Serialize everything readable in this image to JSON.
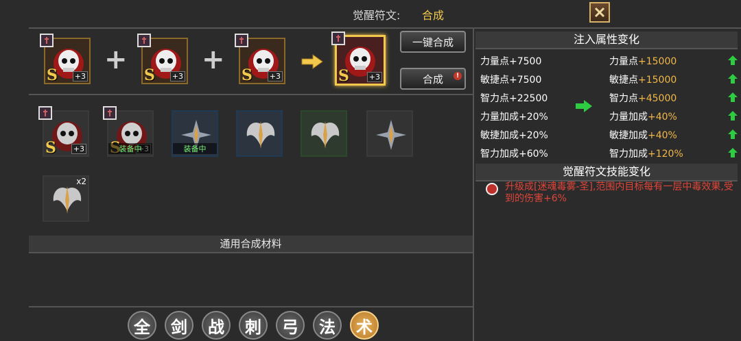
{
  "header": {
    "label": "觉醒符文:",
    "value": "合成"
  },
  "synthesis": {
    "inputs": [
      {
        "grade": "S",
        "level": "+3"
      },
      {
        "grade": "S",
        "level": "+3"
      },
      {
        "grade": "S",
        "level": "+3"
      }
    ],
    "result": {
      "grade": "S",
      "level": "+3"
    },
    "one_click_label": "一键合成",
    "synth_label": "合成",
    "alert": "!"
  },
  "inventory": [
    {
      "kind": "skull",
      "grade": "S",
      "level": "+3",
      "tagged": true
    },
    {
      "kind": "skull",
      "grade": "S",
      "level": "+3",
      "tagged": true,
      "status": "装备中"
    },
    {
      "kind": "wings-star",
      "status": "装备中"
    },
    {
      "kind": "wings"
    },
    {
      "kind": "wings"
    },
    {
      "kind": "wings-star"
    },
    {
      "kind": "wings",
      "qty": "x2"
    }
  ],
  "materials": {
    "title": "通用合成材料"
  },
  "filters": [
    "全",
    "剑",
    "战",
    "刺",
    "弓",
    "法",
    "术"
  ],
  "active_filter": "术",
  "attr_panel": {
    "title": "注入属性变化",
    "rows": [
      {
        "before_label": "力量点",
        "before_value": "+7500",
        "after_label": "力量点",
        "after_value": "+15000"
      },
      {
        "before_label": "敏捷点",
        "before_value": "+7500",
        "after_label": "敏捷点",
        "after_value": "+15000"
      },
      {
        "before_label": "智力点",
        "before_value": "+22500",
        "after_label": "智力点",
        "after_value": "+45000"
      },
      {
        "before_label": "力量加成",
        "before_value": "+20%",
        "after_label": "力量加成",
        "after_value": "+40%"
      },
      {
        "before_label": "敏捷加成",
        "before_value": "+20%",
        "after_label": "敏捷加成",
        "after_value": "+40%"
      },
      {
        "before_label": "智力加成",
        "before_value": "+60%",
        "after_label": "智力加成",
        "after_value": "+120%"
      }
    ]
  },
  "skill_panel": {
    "title": "觉醒符文技能变化",
    "text": "升级成[迷魂毒雾-圣],范围内目标每有一层中毒效果,受到的伤害+6%"
  },
  "colors": {
    "accent": "#f2c94c",
    "increase": "#2ecc40",
    "skill": "#e0453a"
  }
}
